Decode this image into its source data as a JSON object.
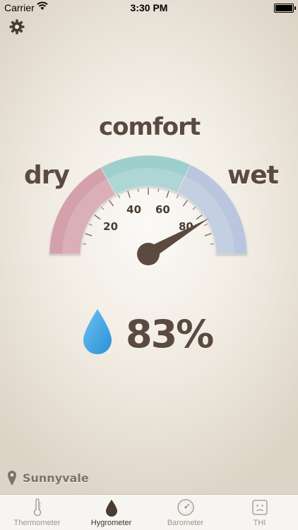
{
  "status_bar": {
    "carrier": "Carrier",
    "time": "3:30 PM"
  },
  "header": {
    "settings_icon": "gear-icon"
  },
  "gauge": {
    "zone_labels": {
      "dry": "dry",
      "comfort": "comfort",
      "wet": "wet"
    },
    "tick_labels": [
      "20",
      "40",
      "60",
      "80"
    ],
    "needle_value_percent": 83,
    "colors": {
      "dry": "#d4a0aa",
      "comfort": "#9fcfcd",
      "wet": "#b9c6dd",
      "needle": "#5a4a3f"
    }
  },
  "reading": {
    "value": "83%",
    "icon": "water-drop-icon",
    "icon_color": "#3aa2e0"
  },
  "location": {
    "name": "Sunnyvale",
    "icon": "location-pin-icon"
  },
  "tabs": [
    {
      "label": "Thermometer",
      "icon": "thermometer-icon",
      "active": false
    },
    {
      "label": "Hygrometer",
      "icon": "drop-icon",
      "active": true
    },
    {
      "label": "Barometer",
      "icon": "barometer-icon",
      "active": false
    },
    {
      "label": "THI",
      "icon": "sad-face-icon",
      "active": false
    }
  ]
}
